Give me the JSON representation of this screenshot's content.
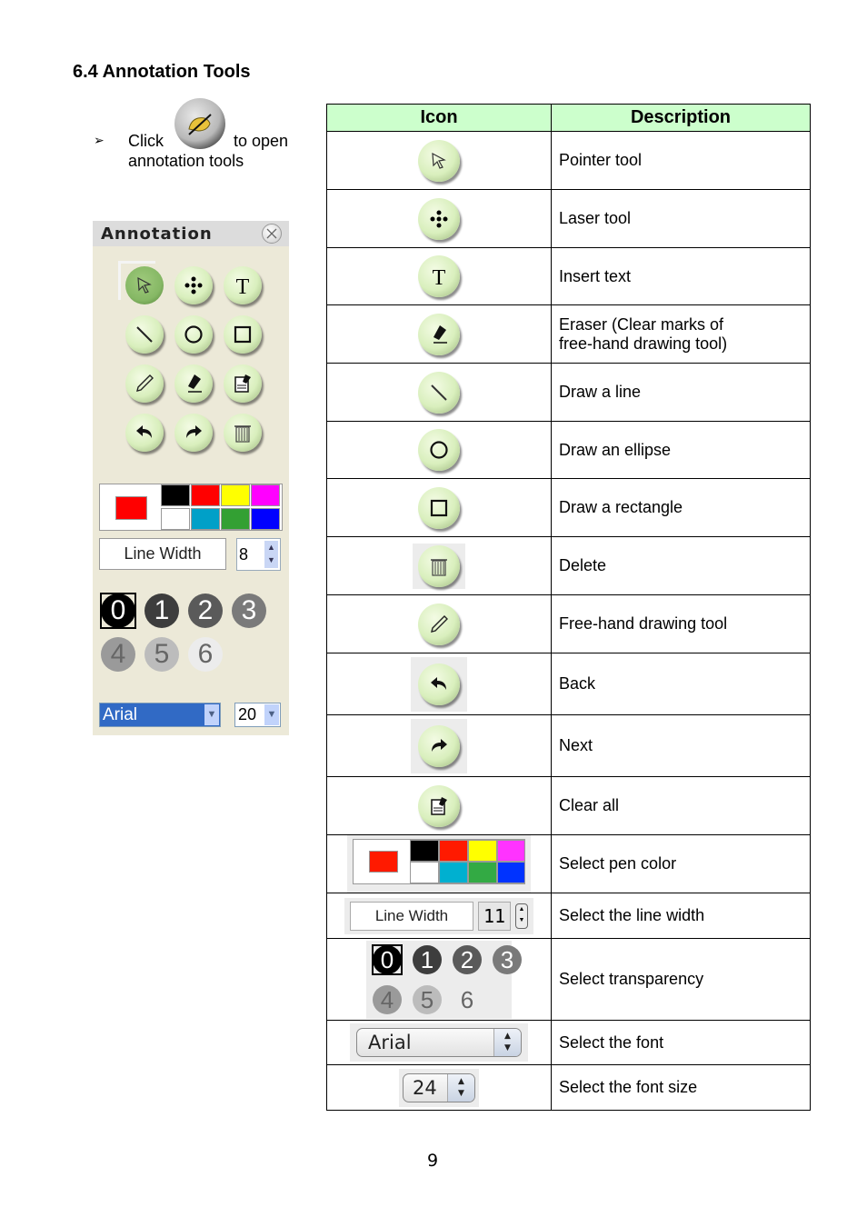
{
  "heading": "6.4  Annotation Tools",
  "instruction": {
    "bullet": "➢",
    "click": "Click",
    "to_open": "to open",
    "annotation_tools": "annotation tools",
    "launch_icon": "annotation-pen-icon"
  },
  "panel": {
    "title": "Annotation",
    "close_icon": "close-icon",
    "tools": [
      {
        "name": "pointer",
        "icon": "pointer-icon",
        "active": true
      },
      {
        "name": "laser",
        "icon": "laser-icon",
        "active": false
      },
      {
        "name": "text",
        "icon": "text-icon",
        "active": false
      },
      {
        "name": "line",
        "icon": "line-icon",
        "active": false
      },
      {
        "name": "ellipse",
        "icon": "ellipse-icon",
        "active": false
      },
      {
        "name": "rectangle",
        "icon": "rectangle-icon",
        "active": false
      },
      {
        "name": "freehand",
        "icon": "pencil-icon",
        "active": false
      },
      {
        "name": "eraser",
        "icon": "eraser-icon",
        "active": false
      },
      {
        "name": "clear-all",
        "icon": "clear-all-icon",
        "active": false
      },
      {
        "name": "back",
        "icon": "undo-icon",
        "active": false
      },
      {
        "name": "next",
        "icon": "redo-icon",
        "active": false
      },
      {
        "name": "delete",
        "icon": "trash-icon",
        "active": false
      }
    ],
    "current_color": "#ff0000",
    "palette": [
      "#000000",
      "#ff0000",
      "#ffff00",
      "#ff00ff",
      "#ffffff",
      "#00a0c8",
      "#33a033",
      "#0000ff"
    ],
    "line_width_label": "Line Width",
    "line_width_value": "8",
    "transparency": {
      "selected": "0",
      "levels": [
        {
          "label": "0",
          "bg": "#000000",
          "fg": "#ffffff"
        },
        {
          "label": "1",
          "bg": "#3d3d3d",
          "fg": "#ffffff"
        },
        {
          "label": "2",
          "bg": "#5a5a5a",
          "fg": "#ffffff"
        },
        {
          "label": "3",
          "bg": "#7a7a7a",
          "fg": "#ffffff"
        },
        {
          "label": "4",
          "bg": "#9a9a9a",
          "fg": "#666666"
        },
        {
          "label": "5",
          "bg": "#bcbcbc",
          "fg": "#666666"
        },
        {
          "label": "6",
          "bg": "#ececec",
          "fg": "#666666"
        }
      ]
    },
    "font_value": "Arial",
    "font_size_value": "20"
  },
  "table": {
    "headers": [
      "Icon",
      "Description"
    ],
    "rows": [
      {
        "icon": "pointer-icon",
        "description": "Pointer tool"
      },
      {
        "icon": "laser-icon",
        "description": "Laser tool"
      },
      {
        "icon": "text-icon",
        "description": "Insert text"
      },
      {
        "icon": "eraser-icon",
        "description": "Eraser (Clear marks of free-hand drawing tool)"
      },
      {
        "icon": "line-icon",
        "description": "Draw a line"
      },
      {
        "icon": "ellipse-icon",
        "description": "Draw an ellipse"
      },
      {
        "icon": "rectangle-icon",
        "description": "Draw a rectangle"
      },
      {
        "icon": "trash-icon",
        "description": "Delete"
      },
      {
        "icon": "pencil-icon",
        "description": "Free-hand drawing tool"
      },
      {
        "icon": "undo-icon",
        "description": "Back"
      },
      {
        "icon": "redo-icon",
        "description": "Next"
      },
      {
        "icon": "clear-all-icon",
        "description": "Clear all"
      },
      {
        "icon": "color-palette",
        "description": "Select pen color"
      },
      {
        "icon": "line-width-control",
        "description": "Select the line width",
        "line_width_label": "Line Width",
        "line_width_value": "11"
      },
      {
        "icon": "transparency-control",
        "description": "Select transparency"
      },
      {
        "icon": "font-select",
        "description": "Select the font",
        "font_value": "Arial"
      },
      {
        "icon": "font-size-select",
        "description": "Select the font size",
        "font_size_value": "24"
      }
    ]
  },
  "page_number": "9"
}
